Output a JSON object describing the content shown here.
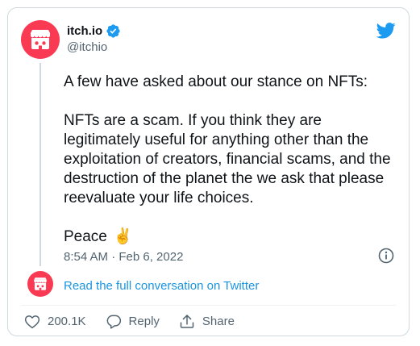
{
  "tweet": {
    "display_name": "itch.io",
    "handle": "@itchio",
    "paragraphs": [
      "A few have asked about our stance on NFTs:",
      "NFTs are a scam. If you think they are legitimately useful for anything other than the exploitation of creators, financial scams, and the destruction of the planet the we ask that please reevaluate your life choices."
    ],
    "closing_text": "Peace",
    "closing_emoji": "✌️",
    "timestamp": "8:54 AM · Feb 6, 2022",
    "read_conversation_link": "Read the full conversation on Twitter"
  },
  "actions": {
    "like_count": "200.1K",
    "reply_label": "Reply",
    "share_label": "Share"
  },
  "colors": {
    "brand_avatar": "#fa3a53",
    "twitter_blue": "#1d9bf0",
    "link_blue": "#1b95e0",
    "secondary_text": "#536471"
  },
  "icons": {
    "verified": "verified-badge-icon",
    "twitter": "twitter-bird-icon",
    "info": "info-icon",
    "like": "heart-icon",
    "reply": "reply-bubble-icon",
    "share": "share-icon"
  }
}
